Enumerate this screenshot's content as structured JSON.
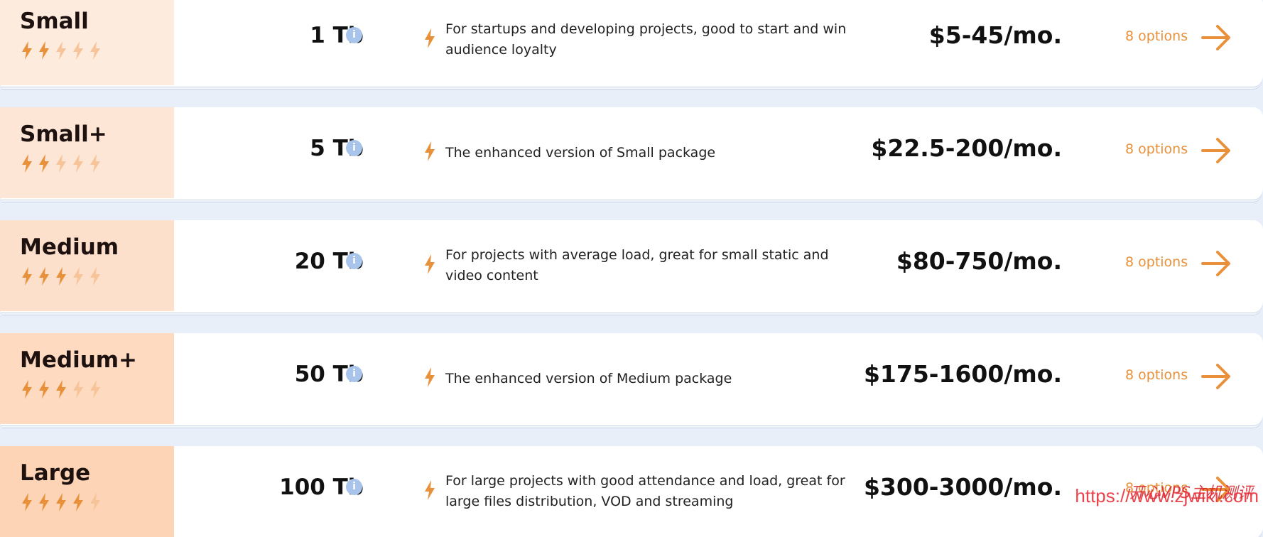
{
  "colors": {
    "accent": "#e8913a",
    "bolt_off": "#f7c49a",
    "info": "#a9c4ea",
    "background": "#e9eff9"
  },
  "plans": [
    {
      "name": "Small",
      "level": 2,
      "max_level": 5,
      "storage": "1 Tb",
      "description": "For startups and developing projects, good to start and win audience loyalty",
      "price": "$5-45/mo.",
      "options": "8 options",
      "panel_color": "#fdebde"
    },
    {
      "name": "Small+",
      "level": 2,
      "max_level": 5,
      "storage": "5 Tb",
      "description": "The enhanced version of Small package",
      "price": "$22.5-200/mo.",
      "options": "8 options",
      "panel_color": "#fde6d6"
    },
    {
      "name": "Medium",
      "level": 3,
      "max_level": 5,
      "storage": "20 Tb",
      "description": "For projects with average load, great for small static and video content",
      "price": "$80-750/mo.",
      "options": "8 options",
      "panel_color": "#fde0cb"
    },
    {
      "name": "Medium+",
      "level": 3,
      "max_level": 5,
      "storage": "50 Tb",
      "description": "The enhanced version of Medium package",
      "price": "$175-1600/mo.",
      "options": "8 options",
      "panel_color": "#fddac0"
    },
    {
      "name": "Large",
      "level": 4,
      "max_level": 5,
      "storage": "100 Tb",
      "description": "For large projects with good attendance and load, great for large files distribution, VOD and streaming",
      "price": "$300-3000/mo.",
      "options": "8 options",
      "panel_color": "#fdd5b6"
    }
  ],
  "icons": {
    "level": "lightning-bolt-icon",
    "info": "info-icon",
    "arrow": "arrow-right-icon"
  },
  "watermark": {
    "url": "https://www.zjwiki.com",
    "text": "开心VPS主机测评"
  }
}
